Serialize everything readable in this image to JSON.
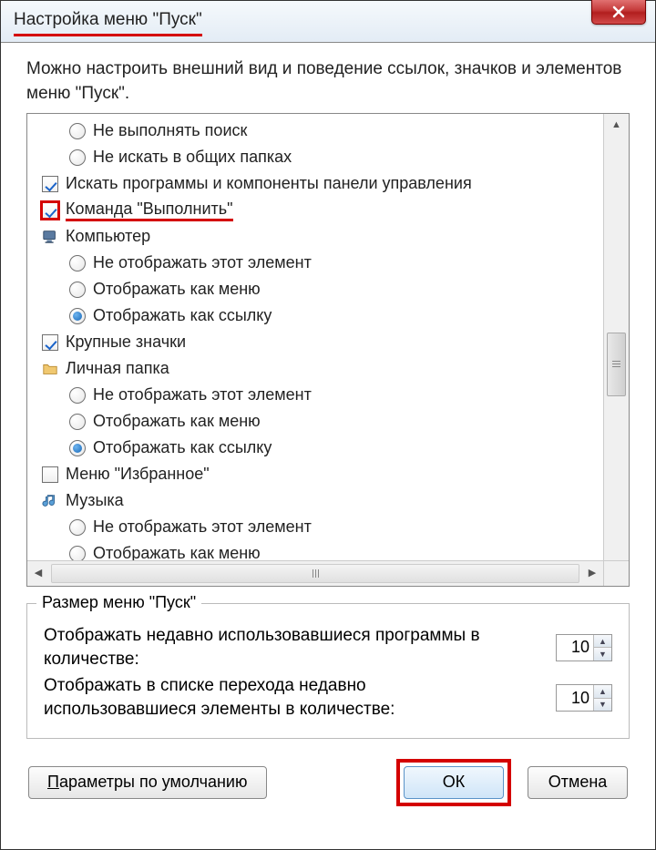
{
  "window": {
    "title": "Настройка меню \"Пуск\""
  },
  "description": "Можно настроить внешний вид и поведение ссылок, значков и элементов меню \"Пуск\".",
  "items": [
    {
      "type": "radio",
      "level": 1,
      "label": "Не выполнять поиск",
      "selected": false
    },
    {
      "type": "radio",
      "level": 1,
      "label": "Не искать в общих папках",
      "selected": false
    },
    {
      "type": "checkbox",
      "level": 0,
      "label": "Искать программы и компоненты панели управления",
      "checked": true
    },
    {
      "type": "checkbox",
      "level": 0,
      "label": "Команда \"Выполнить\"",
      "checked": true,
      "highlight": true
    },
    {
      "type": "icon",
      "level": 0,
      "label": "Компьютер",
      "icon": "computer"
    },
    {
      "type": "radio",
      "level": 1,
      "label": "Не отображать этот элемент",
      "selected": false
    },
    {
      "type": "radio",
      "level": 1,
      "label": "Отображать как меню",
      "selected": false
    },
    {
      "type": "radio",
      "level": 1,
      "label": "Отображать как ссылку",
      "selected": true
    },
    {
      "type": "checkbox",
      "level": 0,
      "label": "Крупные значки",
      "checked": true
    },
    {
      "type": "icon",
      "level": 0,
      "label": "Личная папка",
      "icon": "folder"
    },
    {
      "type": "radio",
      "level": 1,
      "label": "Не отображать этот элемент",
      "selected": false
    },
    {
      "type": "radio",
      "level": 1,
      "label": "Отображать как меню",
      "selected": false
    },
    {
      "type": "radio",
      "level": 1,
      "label": "Отображать как ссылку",
      "selected": true
    },
    {
      "type": "checkbox",
      "level": 0,
      "label": "Меню \"Избранное\"",
      "checked": false
    },
    {
      "type": "icon",
      "level": 0,
      "label": "Музыка",
      "icon": "music"
    },
    {
      "type": "radio",
      "level": 1,
      "label": "Не отображать этот элемент",
      "selected": false
    },
    {
      "type": "radio",
      "level": 1,
      "label": "Отображать как меню",
      "selected": false
    }
  ],
  "group": {
    "title": "Размер меню \"Пуск\"",
    "programs_label": "Отображать недавно использовавшиеся программы в количестве:",
    "programs_value": "10",
    "jumplist_label": "Отображать в списке перехода недавно использовавшиеся элементы в количестве:",
    "jumplist_value": "10"
  },
  "buttons": {
    "defaults_label": "Параметры по умолчанию",
    "defaults_hotkey": "П",
    "ok_label": "ОК",
    "cancel_label": "Отмена"
  }
}
